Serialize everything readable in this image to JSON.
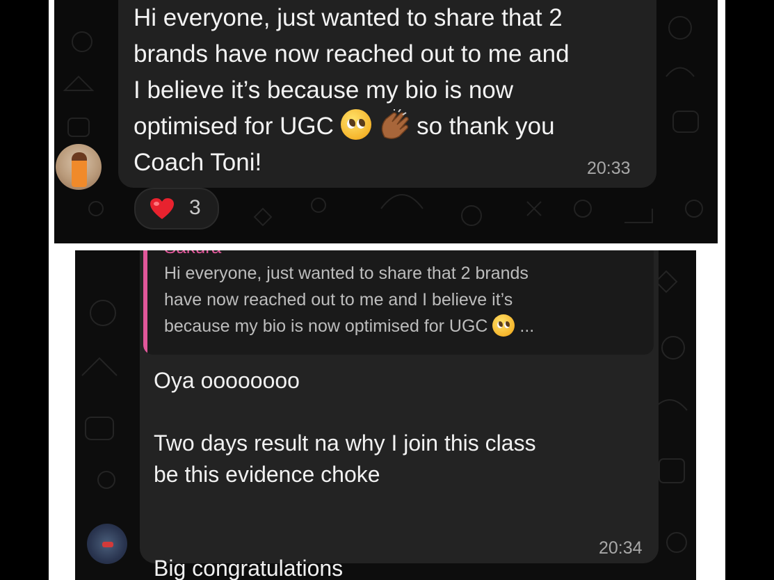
{
  "messages": [
    {
      "text_line1": "Hi everyone, just wanted to share that 2",
      "text_line2": "brands have now reached out to me and",
      "text_line3": "I believe it’s because my bio is now",
      "text_line4_pre": "optimised for UGC",
      "text_line4_post": "so thank you",
      "text_line5": "Coach Toni!",
      "emojis": [
        "pleading-face-icon",
        "clapping-hands-icon"
      ],
      "time": "20:33",
      "reaction": {
        "emoji": "red-heart-icon",
        "count": "3"
      }
    },
    {
      "quoted_message": {
        "sender": "Sakura",
        "line1": "Hi everyone, just wanted to share that 2 brands",
        "line2": "have now reached out to me and I believe it’s",
        "line3_pre": "because my bio is now optimised for UGC",
        "line3_post": "..."
      },
      "line1": "Oya oooooooo",
      "line2": "Two days result na why I join this class",
      "line3": "be this evidence choke",
      "line4": "Big congratulations",
      "time": "20:34"
    }
  ],
  "colors": {
    "bubble": "#212121",
    "quote_accent": "#e0579a",
    "background": "#0b0b0b",
    "heart": "#e8222e"
  }
}
